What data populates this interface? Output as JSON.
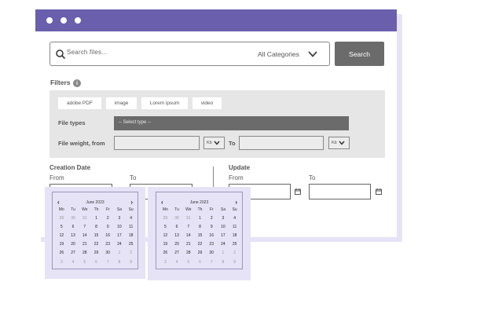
{
  "titlebar": {
    "dots": [
      "window-dot-1",
      "window-dot-2",
      "window-dot-3"
    ]
  },
  "search": {
    "placeholder": "Search files...",
    "category": "All Categories",
    "button": "Search"
  },
  "filters": {
    "label": "Filters",
    "info": "i",
    "tags": [
      "adobe PDF",
      "image",
      "Lorem ipsum",
      "video"
    ],
    "file_types_label": "File types",
    "file_types_value": "-- Select type --",
    "weight_label": "File weight, from",
    "unit_from": "Kb",
    "to_label": "To",
    "unit_to": "Kb"
  },
  "creation": {
    "title": "Creation Date",
    "from": "From",
    "to": "To"
  },
  "update": {
    "title": "Update",
    "from": "From",
    "to": "To"
  },
  "calendars": [
    {
      "month": "June 2023",
      "weekdays": [
        "Mo",
        "Tu",
        "We",
        "Th",
        "Fr",
        "Sa",
        "Su"
      ],
      "days": [
        "29",
        "30",
        "31",
        "1",
        "2",
        "3",
        "4",
        "5",
        "6",
        "7",
        "8",
        "9",
        "10",
        "11",
        "12",
        "13",
        "14",
        "15",
        "16",
        "17",
        "18",
        "19",
        "20",
        "21",
        "22",
        "23",
        "24",
        "25",
        "26",
        "27",
        "28",
        "29",
        "30",
        "1",
        "2",
        "3",
        "4",
        "5",
        "6",
        "7",
        "8",
        "9"
      ],
      "muted": [
        0,
        1,
        2,
        33,
        34,
        35,
        36,
        37,
        38,
        39,
        40,
        41
      ]
    },
    {
      "month": "June 2023",
      "weekdays": [
        "Mo",
        "Tu",
        "We",
        "Th",
        "Fr",
        "Sa",
        "Su"
      ],
      "days": [
        "29",
        "30",
        "31",
        "1",
        "2",
        "3",
        "4",
        "5",
        "6",
        "7",
        "8",
        "9",
        "10",
        "11",
        "12",
        "13",
        "14",
        "15",
        "16",
        "17",
        "18",
        "19",
        "20",
        "21",
        "22",
        "23",
        "24",
        "25",
        "26",
        "27",
        "28",
        "29",
        "30",
        "1",
        "2",
        "3",
        "4",
        "5",
        "6",
        "7",
        "8",
        "9"
      ],
      "muted": [
        0,
        1,
        2,
        33,
        34,
        35,
        36,
        37,
        38,
        39,
        40,
        41
      ]
    }
  ],
  "colors": {
    "accent": "#6a5fac",
    "panel_shadow": "#e6e3f7",
    "button": "#6b6b6b"
  }
}
